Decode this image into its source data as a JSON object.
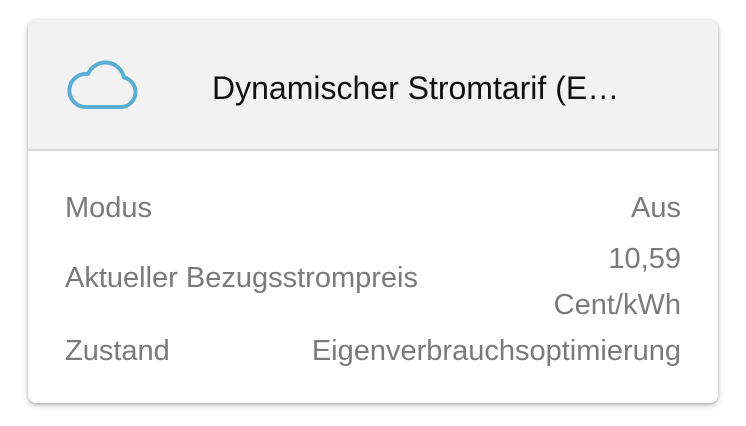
{
  "header": {
    "icon": "cloud-icon",
    "icon_color": "#5aaed6",
    "title": "Dynamischer Stromtarif (E…"
  },
  "rows": [
    {
      "label": "Modus",
      "value": "Aus"
    },
    {
      "label": "Aktueller Bezugsstrompreis",
      "value_line1": "10,59",
      "value_line2": "Cent/kWh"
    },
    {
      "label": "Zustand",
      "value": "Eigenverbrauchsoptimierung"
    }
  ]
}
